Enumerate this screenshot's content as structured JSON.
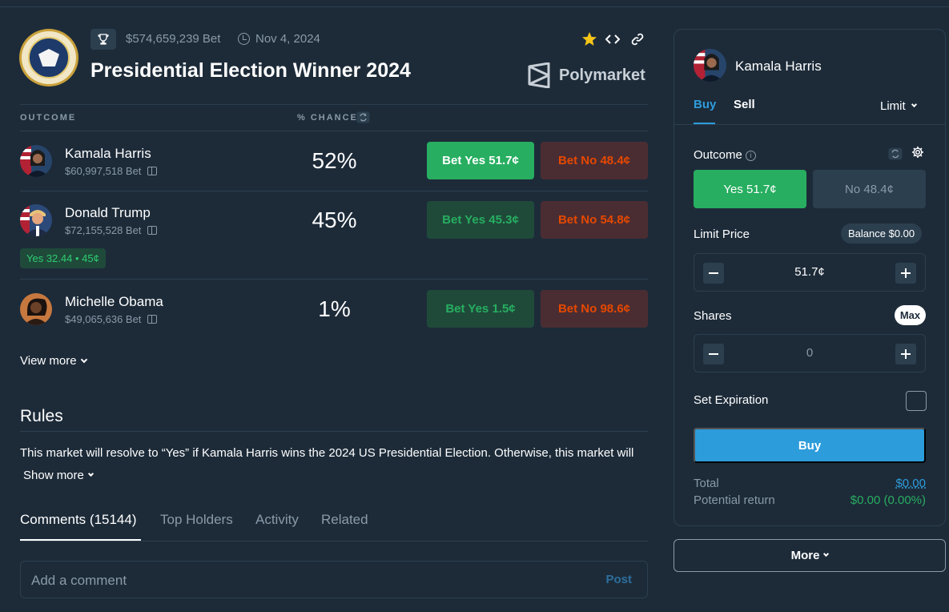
{
  "header": {
    "volume": "$574,659,239 Bet",
    "date": "Nov 4, 2024",
    "title": "Presidential Election Winner 2024",
    "brand": "Polymarket"
  },
  "table": {
    "col_outcome": "OUTCOME",
    "col_chance": "% CHANCE",
    "rows": [
      {
        "name": "Kamala Harris",
        "volume": "$60,997,518 Bet",
        "chance": "52%",
        "yes": "Bet Yes 51.7¢",
        "no": "Bet No 48.4¢"
      },
      {
        "name": "Donald Trump",
        "volume": "$72,155,528 Bet",
        "chance": "45%",
        "yes": "Bet Yes 45.3¢",
        "no": "Bet No 54.8¢",
        "position": "Yes 32.44 • 45¢"
      },
      {
        "name": "Michelle Obama",
        "volume": "$49,065,636 Bet",
        "chance": "1%",
        "yes": "Bet Yes 1.5¢",
        "no": "Bet No 98.6¢"
      }
    ],
    "view_more": "View more"
  },
  "rules": {
    "title": "Rules",
    "text": "This market will resolve to “Yes” if Kamala Harris wins the 2024 US Presidential Election. Otherwise, this market will",
    "show_more": "Show more"
  },
  "tabs": [
    "Comments (15144)",
    "Top Holders",
    "Activity",
    "Related"
  ],
  "comment": {
    "placeholder": "Add a comment",
    "post": "Post"
  },
  "panel": {
    "candidate": "Kamala Harris",
    "buy_tab": "Buy",
    "sell_tab": "Sell",
    "order_type": "Limit",
    "outcome_label": "Outcome",
    "yes": "Yes 51.7¢",
    "no": "No 48.4¢",
    "limit_label": "Limit Price",
    "balance": "Balance $0.00",
    "limit_value": "51.7¢",
    "shares_label": "Shares",
    "max": "Max",
    "shares_value": "0",
    "expiration_label": "Set Expiration",
    "buy_button": "Buy",
    "total_label": "Total",
    "total_value": "$0.00",
    "return_label": "Potential return",
    "return_value": "$0.00 (0.00%)"
  },
  "more_button": "More",
  "colors": {
    "bg": "#1d2b39",
    "yes": "#27ae60",
    "no": "#e64800",
    "accent": "#2d9cdb"
  }
}
